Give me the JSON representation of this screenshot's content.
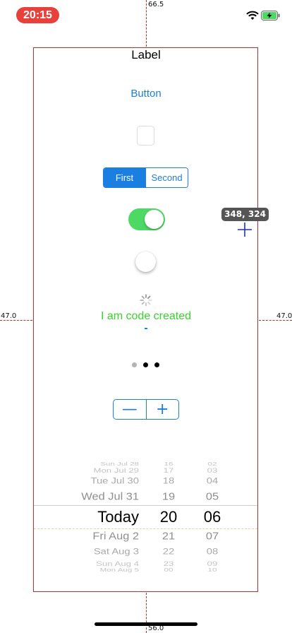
{
  "status_bar": {
    "time": "20:15",
    "time_pill_color": "#e8403a"
  },
  "guides": {
    "top_value": "66.5",
    "left_value": "47.0",
    "right_value": "47.0",
    "bottom_value": "56.0"
  },
  "controls": {
    "label": "Label",
    "button": "Button",
    "segmented": {
      "first": "First",
      "second": "Second",
      "selected": "First"
    },
    "switch_on": true,
    "code_label": "I am code created",
    "page_control": {
      "pages": 3,
      "current": 1
    },
    "stepper": {
      "minus": "—",
      "plus": "+"
    }
  },
  "measure_tooltip": "348, 324",
  "picker": {
    "rows": [
      {
        "date": "Sun Jul 28",
        "hour": "16",
        "minute": "02"
      },
      {
        "date": "Mon Jul 29",
        "hour": "17",
        "minute": "03"
      },
      {
        "date": "Tue Jul 30",
        "hour": "18",
        "minute": "04"
      },
      {
        "date": "Wed Jul 31",
        "hour": "19",
        "minute": "05"
      },
      {
        "date": "Today",
        "hour": "20",
        "minute": "06"
      },
      {
        "date": "Fri Aug 2",
        "hour": "21",
        "minute": "07"
      },
      {
        "date": "Sat Aug 3",
        "hour": "22",
        "minute": "08"
      },
      {
        "date": "Sun Aug 4",
        "hour": "23",
        "minute": "09"
      },
      {
        "date": "Mon Aug 5",
        "hour": "00",
        "minute": "10"
      }
    ],
    "selected_index": 4
  },
  "colors": {
    "accent": "#1a7fe0",
    "switch_on": "#4cd964",
    "guide": "#dd2222",
    "code_label": "#3ad12e"
  }
}
